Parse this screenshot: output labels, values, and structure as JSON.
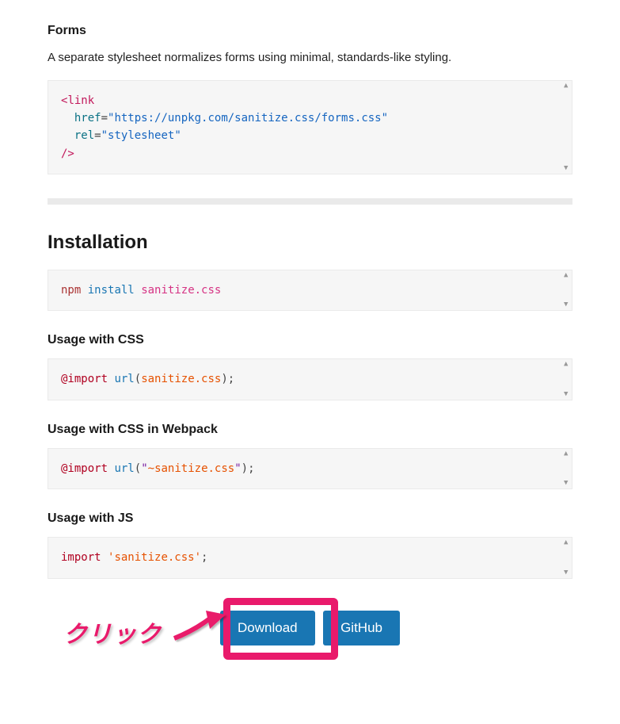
{
  "forms": {
    "title": "Forms",
    "desc": "A separate stylesheet normalizes forms using minimal, standards-like styling.",
    "code": {
      "open": "<",
      "tag": "link",
      "attr1": "href",
      "eq": "=",
      "q": "\"",
      "val1": "https://unpkg.com/sanitize.css/forms.css",
      "attr2": "rel",
      "val2": "stylesheet",
      "close": "/>"
    }
  },
  "installation": {
    "title": "Installation",
    "npm_code": {
      "cmd": "npm",
      "sub": "install",
      "pkg": "sanitize.css"
    }
  },
  "usage_css": {
    "title": "Usage with CSS",
    "code": {
      "at": "@import",
      "fn": "url",
      "open": "(",
      "arg": "sanitize.css",
      "close": ")",
      "semi": ";"
    }
  },
  "usage_webpack": {
    "title": "Usage with CSS in Webpack",
    "code": {
      "at": "@import",
      "fn": "url",
      "open": "(",
      "q": "\"",
      "tilde": "~",
      "arg": "sanitize.css",
      "close": ")",
      "semi": ";"
    }
  },
  "usage_js": {
    "title": "Usage with JS",
    "code": {
      "kw": "import",
      "q": "'",
      "arg": "sanitize.css",
      "semi": ";"
    }
  },
  "buttons": {
    "download": "Download",
    "github": "GitHub"
  },
  "annotation": {
    "label": "クリック"
  }
}
